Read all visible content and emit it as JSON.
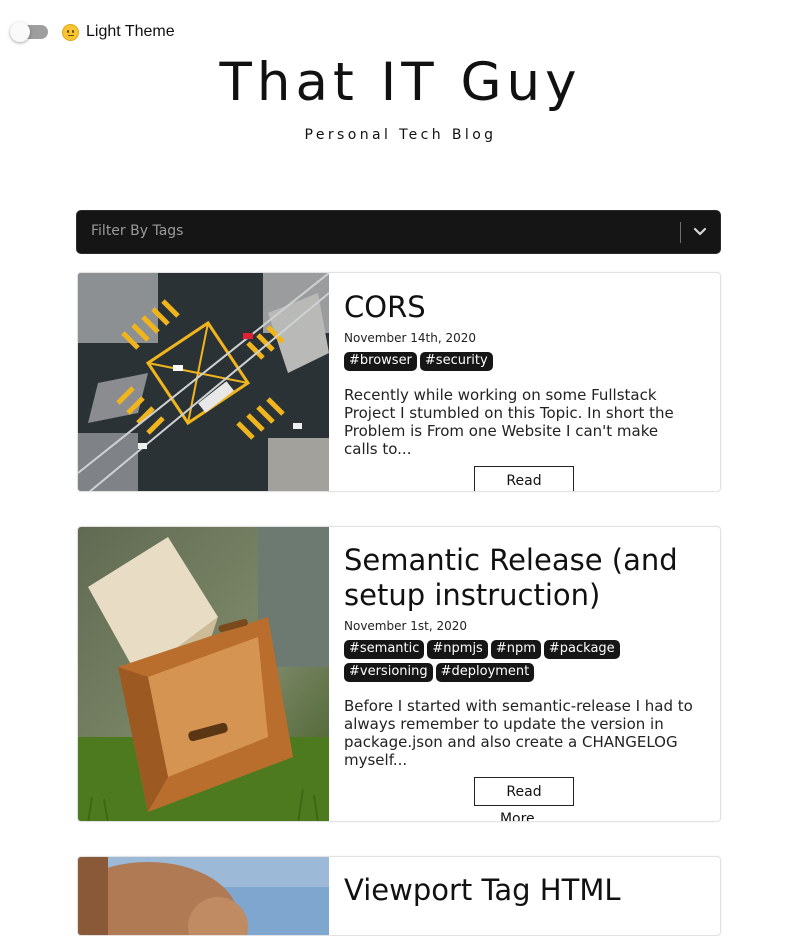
{
  "theme_toggle": {
    "label": "Light Theme",
    "emoji_icon": "smiling-face-icon"
  },
  "site": {
    "title": "That IT Guy",
    "subtitle": "Personal Tech Blog"
  },
  "filter": {
    "placeholder": "Filter By Tags",
    "dropdown_icon": "chevron-down-icon"
  },
  "colors": {
    "filter_bg": "#151515",
    "tag_bg": "#161616",
    "toggle_track": "#9e9e9e"
  },
  "posts": [
    {
      "title": "CORS",
      "date": "November 14th, 2020",
      "tags": [
        "#browser",
        "#security"
      ],
      "excerpt": "Recently while working on some Fullstack Project I stumbled on this Topic. In short the Problem is From one Website I can't make calls to...",
      "read_more": "Read More...",
      "thumbnail": "aerial-crosswalk-intersection-image"
    },
    {
      "title": "Semantic Release (and setup instruction)",
      "date": "November 1st, 2020",
      "tags": [
        "#semantic",
        "#npmjs",
        "#npm",
        "#package",
        "#versioning",
        "#deployment"
      ],
      "excerpt": "Before I started with semantic-release I had to always remember to update the version in package.json and also create a CHANGELOG myself...",
      "read_more": "Read More...",
      "thumbnail": "wooden-crate-on-grass-image"
    },
    {
      "title": "Viewport Tag HTML",
      "thumbnail": "hand-holding-phone-image"
    }
  ]
}
